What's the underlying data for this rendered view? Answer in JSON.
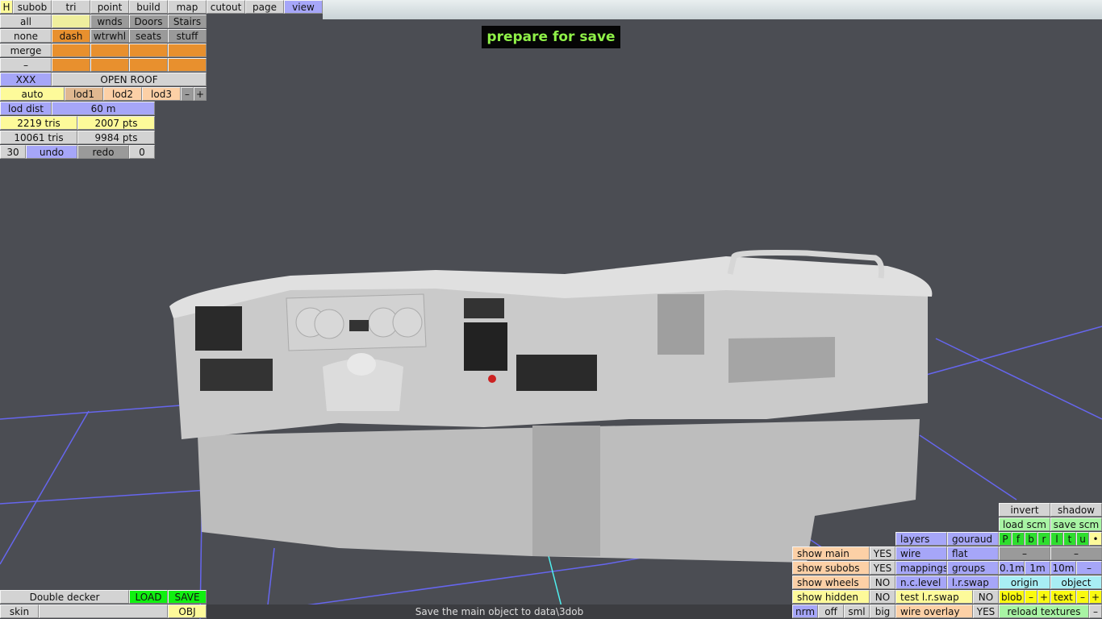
{
  "top_menu": {
    "h": "H",
    "subob": "subob",
    "tri": "tri",
    "point": "point",
    "build": "build",
    "map": "map",
    "cutout": "cutout",
    "page": "page",
    "view": "view"
  },
  "subobjects": {
    "all": "all",
    "blank": "",
    "wnds": "wnds",
    "doors": "Doors",
    "stairs": "Stairs",
    "none": "none",
    "dash": "dash",
    "wtrwhl": "wtrwhl",
    "seats": "seats",
    "stuff": "stuff",
    "merge": "merge",
    "minus": "–",
    "xxx": "XXX",
    "open_roof": "OPEN ROOF"
  },
  "lod": {
    "auto": "auto",
    "lod1": "lod1",
    "lod2": "lod2",
    "lod3": "lod3",
    "minus": "–",
    "plus": "+",
    "dist_label": "lod dist",
    "dist_value": "60 m"
  },
  "stats": {
    "tris_sel": "2219 tris",
    "pts_sel": "2007 pts",
    "tris_total": "10061 tris",
    "pts_total": "9984 pts"
  },
  "history": {
    "count": "30",
    "undo": "undo",
    "redo": "redo",
    "redo_count": "0"
  },
  "banner": "prepare for save",
  "bottom_left": {
    "model": "Double decker",
    "load": "LOAD",
    "save": "SAVE",
    "skin": "skin",
    "skin_value": "",
    "obj": "OBJ"
  },
  "status": "Save the main object to data\\3dob",
  "view_panel": {
    "invert": "invert",
    "shadow": "shadow",
    "load_scm": "load scm",
    "save_scm": "save scm",
    "layers": "layers",
    "gouraud": "gouraud",
    "dirs": [
      "P",
      "f",
      "b",
      "r",
      "l",
      "t",
      "u",
      "•"
    ],
    "show_main": "show main",
    "show_main_val": "YES",
    "wire": "wire",
    "flat": "flat",
    "dash1": "–",
    "dash2": "–",
    "show_subobs": "show subobs",
    "show_subobs_val": "YES",
    "mappings": "mappings",
    "groups": "groups",
    "g01": "0.1m",
    "g1": "1m",
    "g10": "10m",
    "gminus": "–",
    "show_wheels": "show wheels",
    "show_wheels_val": "NO",
    "nclevel": "n.c.level",
    "lrswap": "l.r.swap",
    "origin": "origin",
    "object": "object",
    "show_hidden": "show hidden",
    "show_hidden_val": "NO",
    "test_lrswap": "test l.r.swap",
    "test_lrswap_val": "NO",
    "blob": "blob",
    "blob_minus": "–",
    "blob_plus": "+",
    "text": "text",
    "text_minus": "–",
    "text_plus": "+",
    "nrm": "nrm",
    "off": "off",
    "sml": "sml",
    "big": "big",
    "wire_overlay": "wire overlay",
    "wire_overlay_val": "YES",
    "reload": "reload textures",
    "reload_minus": "–"
  },
  "colors": {
    "background": "#4b4d53",
    "grid": "#6a6af0",
    "model": "#c8c8c8",
    "banner_text": "#8ff048"
  }
}
